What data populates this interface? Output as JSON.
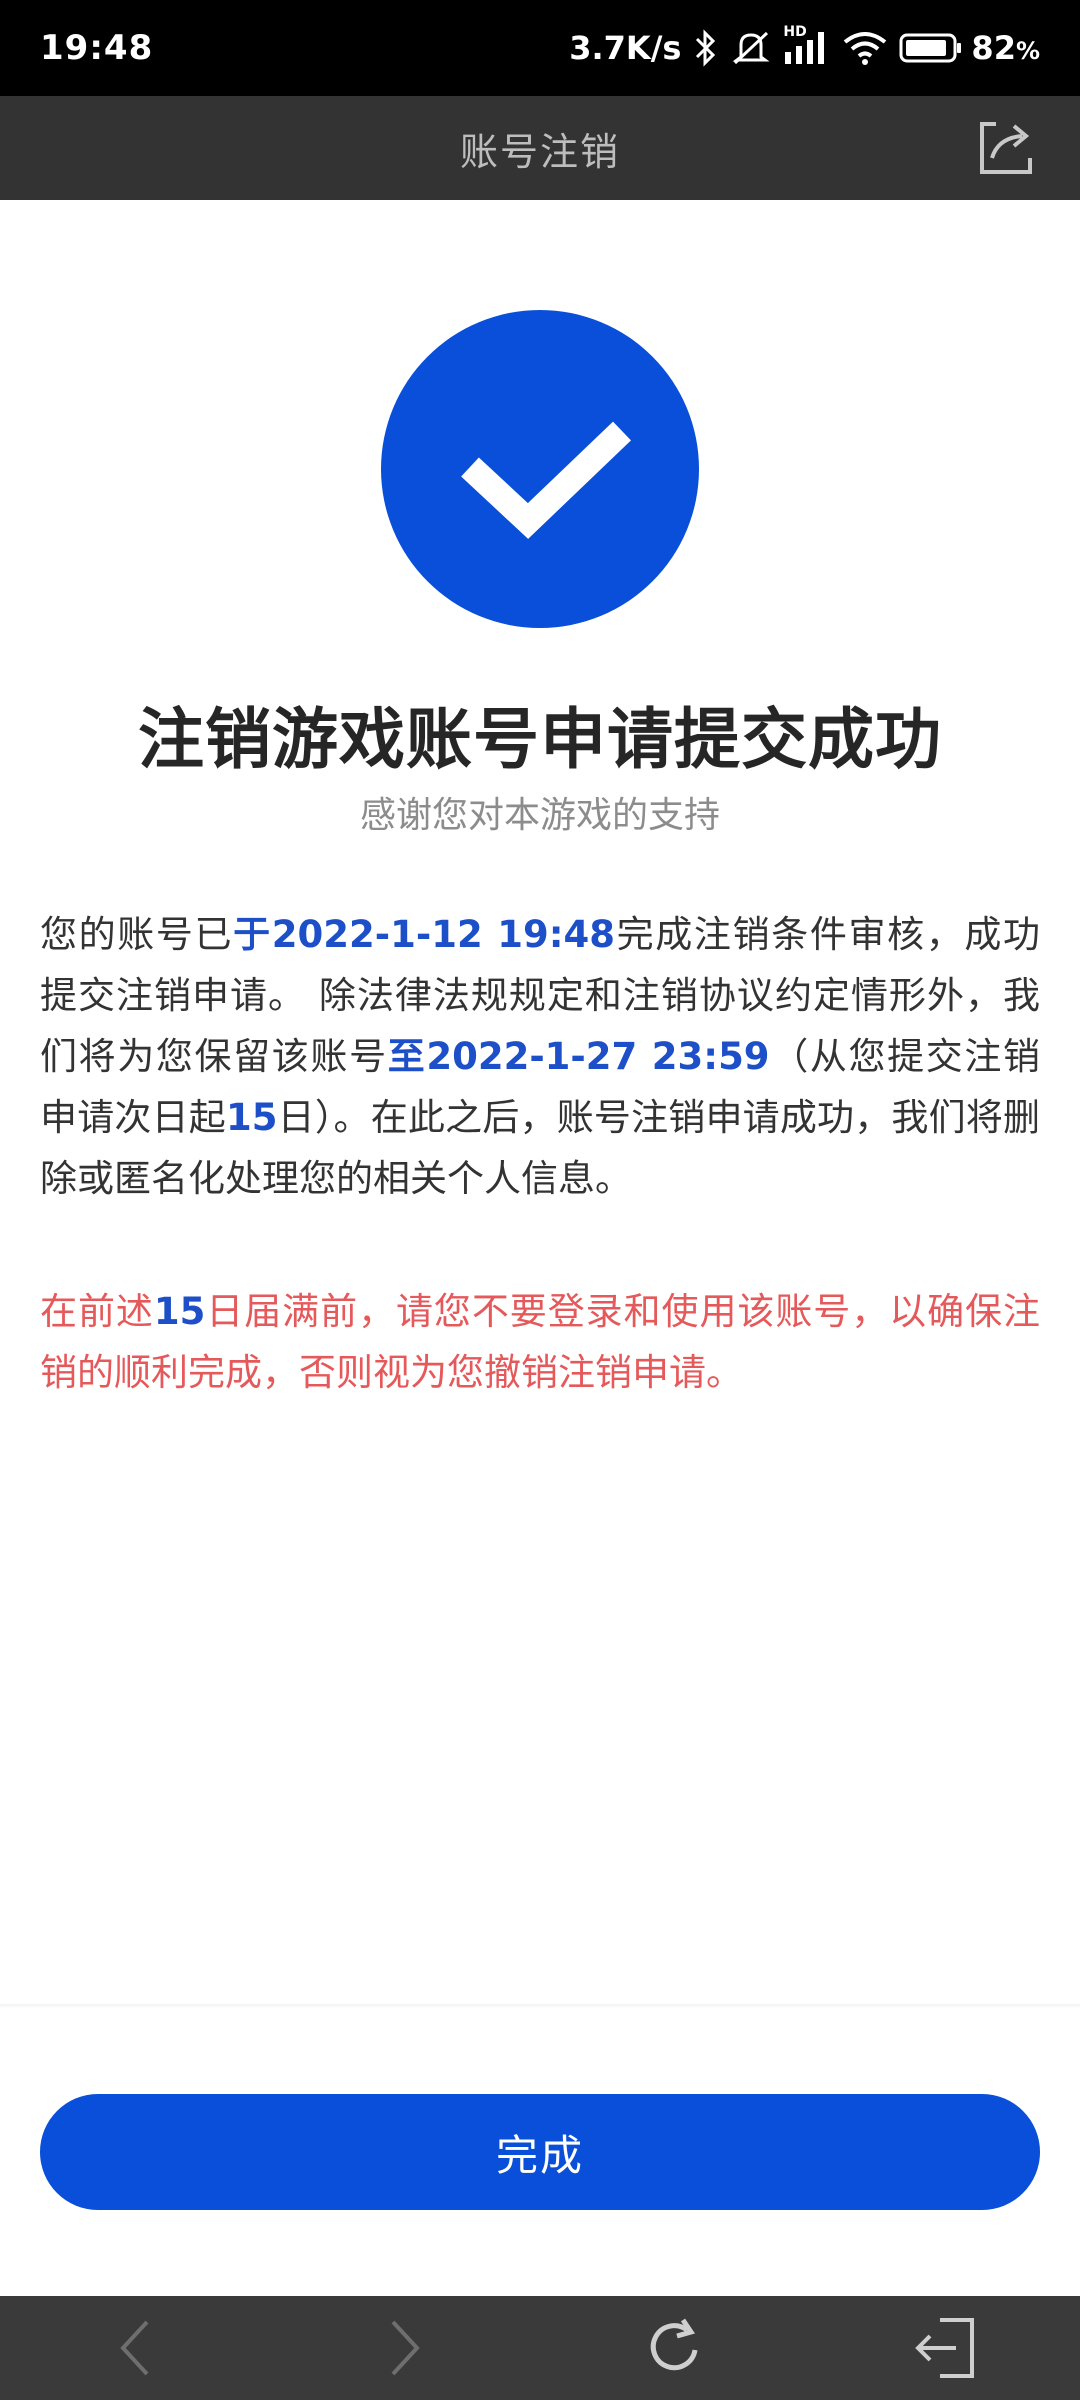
{
  "status_bar": {
    "time": "19:48",
    "network_speed": "3.7K/s",
    "signal_label": "HD",
    "battery": "82",
    "battery_unit": "%"
  },
  "header": {
    "title": "账号注销"
  },
  "success": {
    "title": "注销游戏账号申请提交成功",
    "subtitle": "感谢您对本游戏的支持"
  },
  "info": {
    "p1_a": "您的账号已",
    "p1_b": "于2022-1-12 19:48",
    "p1_c": "完成注销条件审核，成功提交注销申请。 除法律法规规定和注销协议约定情形外，我们将为您保留该账号",
    "p1_d": "至2022-1-27 23:59",
    "p1_e": "（从您提交注销申请次日起",
    "p1_f": "15",
    "p1_g": "日）。在此之后，账号注销申请成功，我们将删除或匿名化处理您的相关个人信息。"
  },
  "warning": {
    "a": "在前述",
    "b": "15",
    "c": "日届满前，请您不要登录和使用该账号，以确保注销的顺利完成，否则视为您撤销注销申请。"
  },
  "actions": {
    "done_label": "完成"
  },
  "colors": {
    "accent": "#0a4fd9",
    "warning": "#e5595b",
    "title_bar": "#333333"
  },
  "icons": {
    "share": "share-icon",
    "back": "back-arrow-icon",
    "forward": "forward-arrow-icon",
    "refresh": "refresh-icon",
    "exit": "exit-icon"
  }
}
